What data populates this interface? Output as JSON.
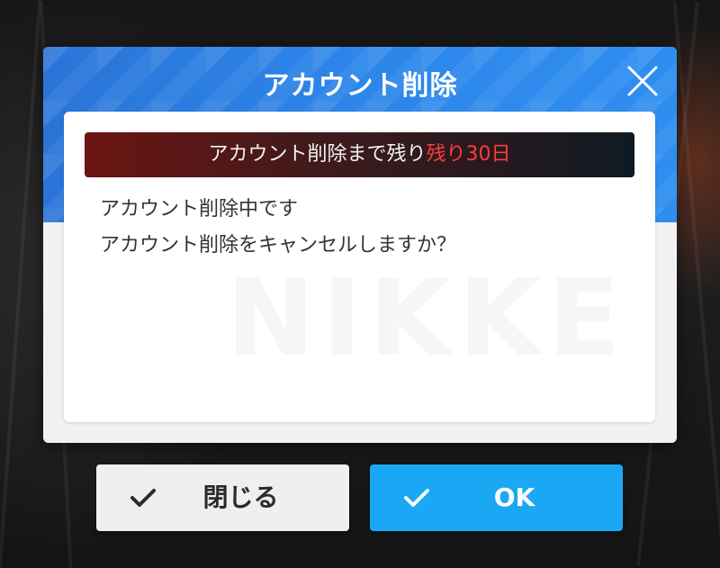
{
  "dialog": {
    "title": "アカウント削除",
    "close_icon": "close-icon",
    "banner": {
      "prefix": "アカウント削除まで残り",
      "highlight": "残り30日",
      "highlight_color": "#ff3b3b"
    },
    "messages": [
      "アカウント削除中です",
      "アカウント削除をキャンセルしますか？"
    ],
    "watermark": "NIKKE"
  },
  "buttons": {
    "close_label": "閉じる",
    "ok_label": "OK",
    "check_icon": "check-icon"
  },
  "colors": {
    "header_blue": "#2d86ea",
    "ok_blue": "#1aa8f5",
    "banner_dark_red": "#6b1512"
  }
}
